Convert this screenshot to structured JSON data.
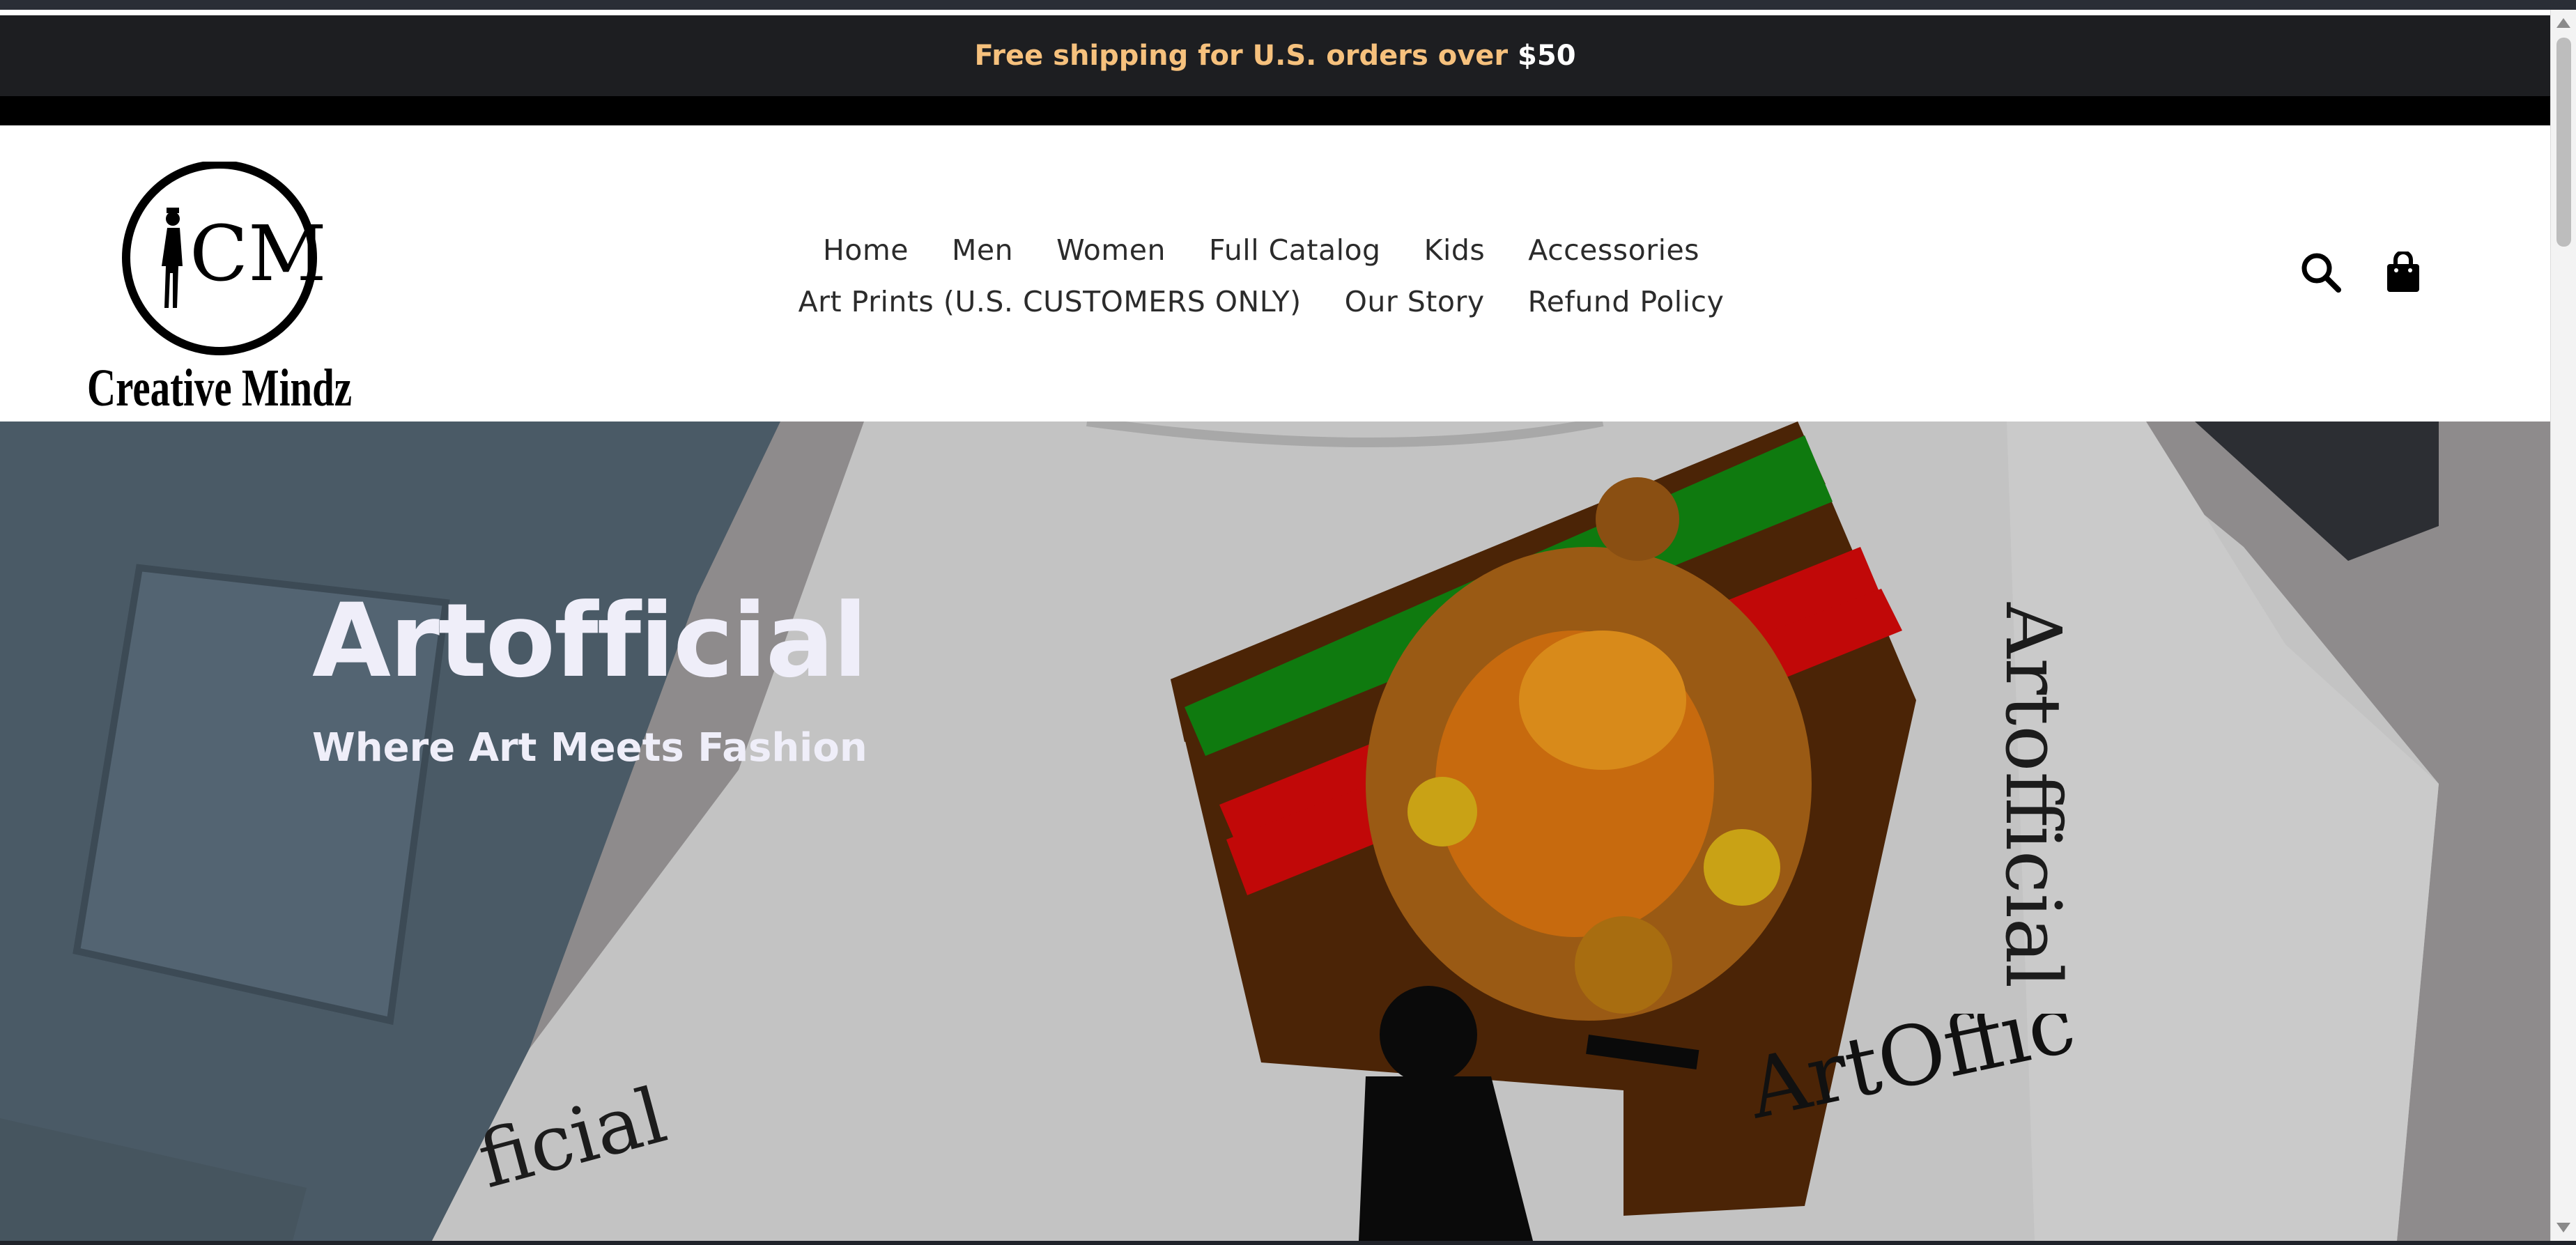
{
  "announcement": {
    "text_prefix": "Free shipping for U.S. orders over ",
    "text_amount": "$50",
    "color": "#f6c17d"
  },
  "header": {
    "logo": {
      "monogram": "CM",
      "name": "Creative Mindz"
    },
    "nav_row1": [
      "Home",
      "Men",
      "Women",
      "Full Catalog",
      "Kids",
      "Accessories"
    ],
    "nav_row2": [
      "Art Prints (U.S. CUSTOMERS ONLY)",
      "Our Story",
      "Refund Policy"
    ],
    "icons": {
      "search": "search-icon",
      "cart": "shopping-bag-icon"
    }
  },
  "hero": {
    "title": "Artofficial",
    "subtitle": "Where Art Meets Fashion",
    "shirt_text": "ArtOffic"
  }
}
